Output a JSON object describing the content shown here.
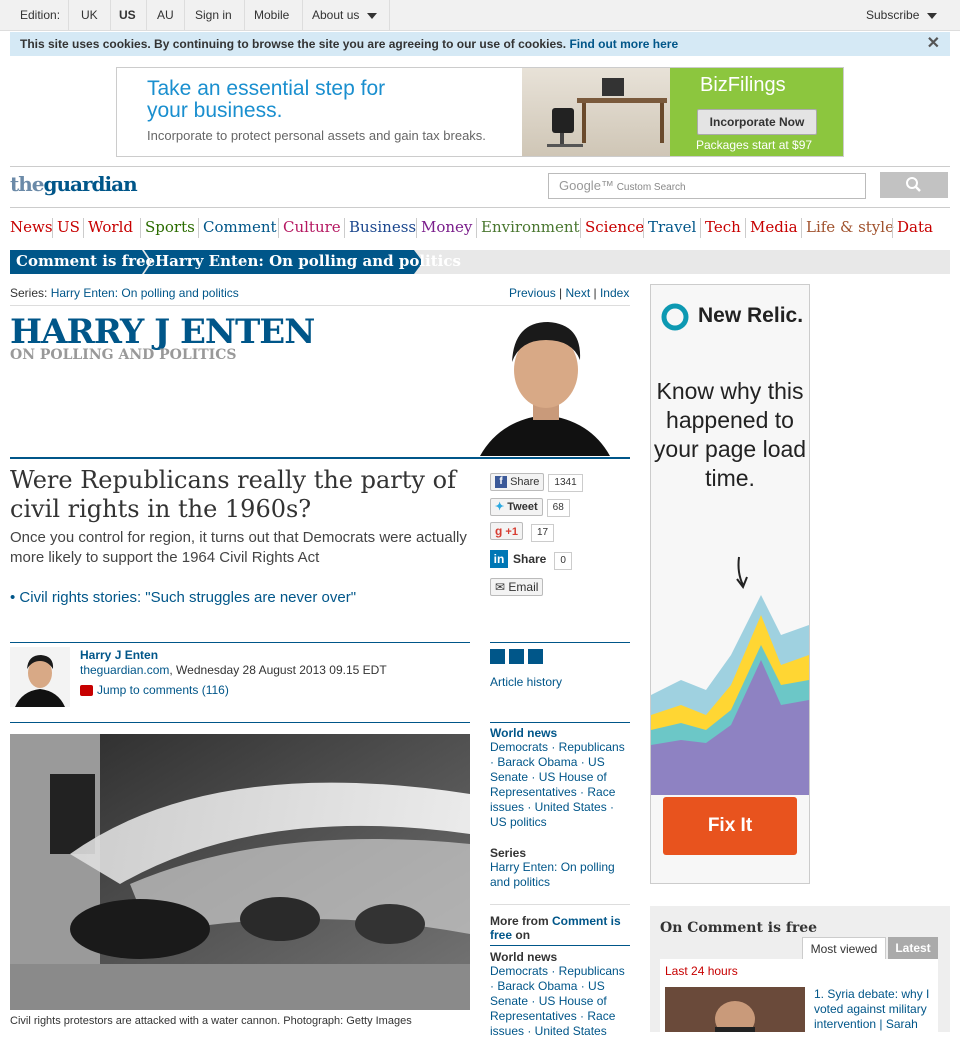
{
  "topbar": {
    "edition_label": "Edition:",
    "editions": [
      "UK",
      "US",
      "AU"
    ],
    "signin": "Sign in",
    "mobile": "Mobile",
    "about": "About us",
    "subscribe": "Subscribe"
  },
  "cookie": {
    "text": "This site uses cookies. By continuing to browse the site you are agreeing to our use of cookies.",
    "link": "Find out more here",
    "close": "✕"
  },
  "top_ad": {
    "headline_line1": "Take an essential step for",
    "headline_line2": "your business.",
    "sub": "Incorporate to protect personal assets and gain tax breaks.",
    "brand": "BizFilings",
    "button": "Incorporate Now",
    "packages": "Packages start at $97"
  },
  "header": {
    "logo_the": "the",
    "logo_guardian": "guardian",
    "search_placeholder": "Custom Search",
    "search_google": "Google™"
  },
  "nav": [
    {
      "label": "News",
      "color": "#c70000"
    },
    {
      "label": "US",
      "color": "#c70000"
    },
    {
      "label": "World",
      "color": "#c70000"
    },
    {
      "label": "Sports",
      "color": "#2b6c00"
    },
    {
      "label": "Comment",
      "color": "#005689"
    },
    {
      "label": "Culture",
      "color": "#b51861"
    },
    {
      "label": "Business",
      "color": "#1b478e"
    },
    {
      "label": "Money",
      "color": "#7a1d8b"
    },
    {
      "label": "Environment",
      "color": "#4a7730"
    },
    {
      "label": "Science",
      "color": "#c70000"
    },
    {
      "label": "Travel",
      "color": "#005689"
    },
    {
      "label": "Tech",
      "color": "#c70000"
    },
    {
      "label": "Media",
      "color": "#c70000"
    },
    {
      "label": "Life & style",
      "color": "#a0522d"
    },
    {
      "label": "Data",
      "color": "#c70000"
    }
  ],
  "breadcrumb": {
    "section": "Comment is free",
    "series": "Harry Enten: On polling and politics"
  },
  "series": {
    "label": "Series:",
    "name": "Harry Enten: On polling and politics",
    "prev": "Previous",
    "next": "Next",
    "index": "Index",
    "banner_name": "HARRY J ENTEN",
    "banner_sub": "ON POLLING AND POLITICS"
  },
  "article": {
    "headline": "Were Republicans really the party of civil rights in the 1960s?",
    "standfirst": "Once you control for region, it turns out that Democrats were actually more likely to support the 1964 Civil Rights Act",
    "related": "• Civil rights stories: \"Such struggles are never over\"",
    "author": "Harry J Enten",
    "source": "theguardian.com",
    "date": ", Wednesday 28 August 2013 09.15 EDT",
    "jump": "Jump to comments (116)",
    "caption": "Civil rights protestors are attacked with a water cannon. Photograph: Getty Images"
  },
  "share": {
    "facebook": "Share",
    "facebook_count": "1341",
    "twitter": "Tweet",
    "twitter_count": "68",
    "gplus": "+1",
    "gplus_count": "17",
    "linkedin": "Share",
    "linkedin_count": "0",
    "email": "Email"
  },
  "sidebar": {
    "history": "Article history",
    "world_news_h": "World news",
    "world_news_links": "Democrats · Republicans · Barack Obama · US Senate · US House of Representatives · Race issues · United States · US politics",
    "series_h": "Series",
    "series_link": "Harry Enten: On polling and politics",
    "more_from": "More from",
    "more_from_link": "Comment is free",
    "more_from_on": "on",
    "world_news_h2": "World news",
    "world_news_links2": "Democrats · Republicans · Barack Obama · US Senate · US House of Representatives · Race issues · United States"
  },
  "right_ad": {
    "brand": "New Relic.",
    "text": "Know why this happened to your page load time.",
    "button": "Fix It"
  },
  "cif_panel": {
    "title": "On Comment is free",
    "tab_most": "Most viewed",
    "tab_latest": "Latest",
    "period": "Last 24 hours",
    "item1": "1. Syria debate: why I voted against military intervention | Sarah"
  }
}
